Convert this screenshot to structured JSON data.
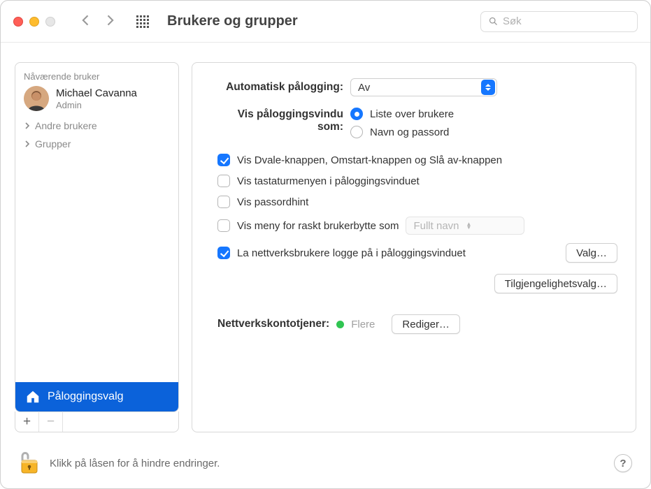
{
  "window": {
    "title": "Brukere og grupper",
    "search_placeholder": "Søk"
  },
  "sidebar": {
    "current_user_section": "Nåværende bruker",
    "user": {
      "name": "Michael Cavanna",
      "role": "Admin"
    },
    "groups": [
      {
        "label": "Andre brukere"
      },
      {
        "label": "Grupper"
      }
    ],
    "login_options": "Påloggingsvalg",
    "add_icon": "+",
    "remove_icon": "−"
  },
  "main": {
    "auto_login_label": "Automatisk pålogging:",
    "auto_login_value": "Av",
    "login_window_label": "Vis påloggingsvindu som:",
    "radio_list": "Liste over brukere",
    "radio_name": "Navn og passord",
    "check_buttons": "Vis Dvale-knappen, Omstart-knappen og Slå av-knappen",
    "check_keyboard": "Vis tastaturmenyen i påloggingsvinduet",
    "check_hint": "Vis passordhint",
    "check_fastswitch": "Vis meny for raskt brukerbytte som",
    "fastswitch_value": "Fullt navn",
    "check_network": "La nettverksbrukere logge på i påloggingsvinduet",
    "btn_options": "Valg…",
    "btn_accessibility": "Tilgjengelighetsvalg…",
    "netserver_label": "Nettverkskontotjener:",
    "netserver_status": "Flere",
    "btn_edit": "Rediger…"
  },
  "footer": {
    "lock_text": "Klikk på låsen for å hindre endringer.",
    "help": "?"
  }
}
